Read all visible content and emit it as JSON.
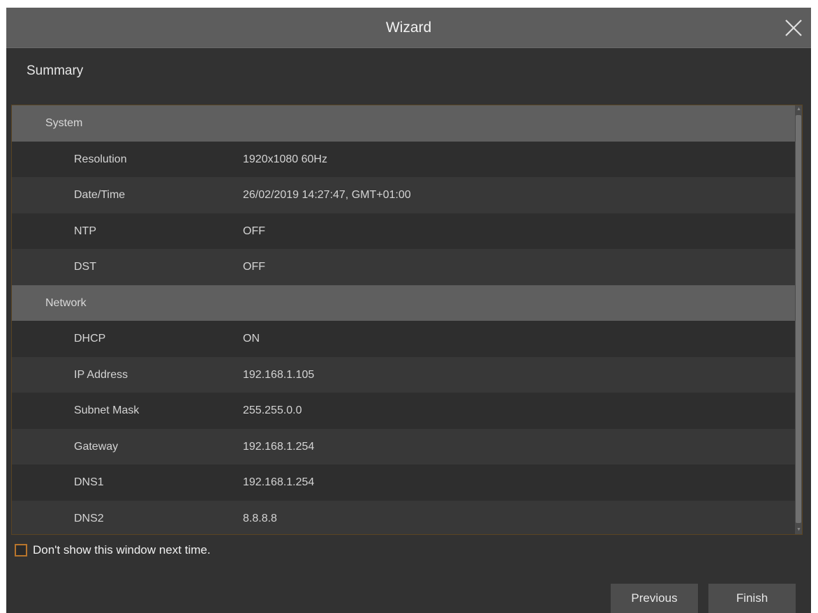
{
  "window": {
    "title": "Wizard",
    "close_icon": "close-icon"
  },
  "page": {
    "heading": "Summary"
  },
  "summary": {
    "system": {
      "label": "System",
      "rows": [
        {
          "label": "Resolution",
          "value": "1920x1080 60Hz"
        },
        {
          "label": "Date/Time",
          "value": "26/02/2019 14:27:47, GMT+01:00"
        },
        {
          "label": "NTP",
          "value": "OFF"
        },
        {
          "label": "DST",
          "value": "OFF"
        }
      ]
    },
    "network": {
      "label": "Network",
      "rows": [
        {
          "label": "DHCP",
          "value": "ON"
        },
        {
          "label": "IP Address",
          "value": "192.168.1.105"
        },
        {
          "label": "Subnet Mask",
          "value": "255.255.0.0"
        },
        {
          "label": "Gateway",
          "value": "192.168.1.254"
        },
        {
          "label": "DNS1",
          "value": "192.168.1.254"
        },
        {
          "label": "DNS2",
          "value": "8.8.8.8"
        }
      ]
    }
  },
  "footer": {
    "dont_show_label": "Don't show this window next time.",
    "dont_show_checked": false,
    "previous_label": "Previous",
    "finish_label": "Finish"
  },
  "colors": {
    "window_bg": "#323232",
    "titlebar_bg": "#5d5d5d",
    "section_bg": "#5f5f5f",
    "accent": "#b8752c"
  }
}
